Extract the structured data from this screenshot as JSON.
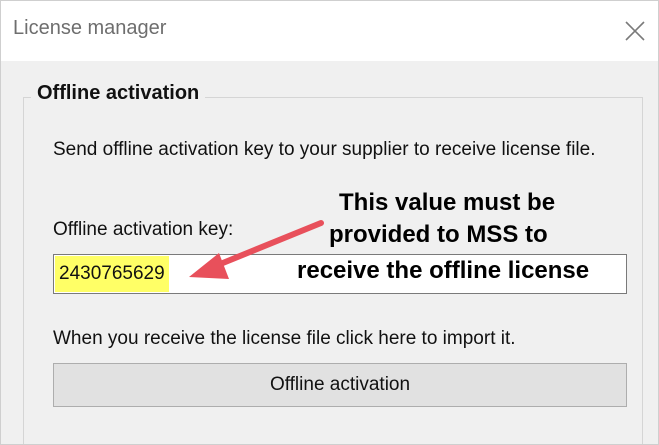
{
  "window": {
    "title": "License manager"
  },
  "group": {
    "title": "Offline activation",
    "description": "Send offline activation key to your supplier to receive license file.",
    "key_label": "Offline activation key:",
    "key_value": "2430765629",
    "receive_text": "When you receive the license file click here to import it.",
    "activate_button_label": "Offline activation"
  },
  "annotation": {
    "line1": "This value must be",
    "line2": "provided to MSS to",
    "line3": "receive the offline license"
  },
  "colors": {
    "highlight": "#ffff66",
    "arrow": "#e8505b"
  },
  "icons": {
    "close": "close-icon",
    "arrow": "arrow-icon"
  }
}
